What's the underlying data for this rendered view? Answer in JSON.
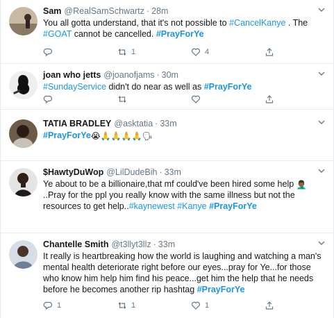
{
  "tweets": [
    {
      "name": "Sam",
      "handle": "@RealSamSchwartz",
      "sep": "·",
      "time": "28m",
      "avatar": "avatar-sam",
      "segments": [
        {
          "t": "You all gotta understand, that it's not possible to ",
          "k": "text"
        },
        {
          "t": "#CancelKanye",
          "k": "tag"
        },
        {
          "t": " . The ",
          "k": "text"
        },
        {
          "t": "#GOAT",
          "k": "tag"
        },
        {
          "t": " cannot be cancelled. ",
          "k": "text"
        },
        {
          "t": "#PrayForYe",
          "k": "tagb"
        }
      ],
      "reply_count": "",
      "retweet_count": "1",
      "like_count": "4"
    },
    {
      "name": "joan who jetts",
      "handle": "@joanofjams",
      "sep": "·",
      "time": "30m",
      "avatar": "avatar-joan",
      "segments": [
        {
          "t": "#SundayService",
          "k": "tag"
        },
        {
          "t": " didn't do near as well as ",
          "k": "text"
        },
        {
          "t": "#PrayForYe",
          "k": "tagb"
        }
      ],
      "reply_count": "",
      "retweet_count": "",
      "like_count": ""
    },
    {
      "name": "TATIA BRADLEY",
      "handle": "@asktatia",
      "sep": "·",
      "time": "33m",
      "avatar": "avatar-tatia",
      "segments": [
        {
          "t": "#PrayForYe",
          "k": "tagb"
        },
        {
          "t": " 😭🙏🙏🙏🙏🗣",
          "k": "emoji"
        }
      ],
      "reply_count": "",
      "retweet_count": "",
      "like_count": ""
    },
    {
      "name": "$HawtyDuWop",
      "handle": "@LilDudeBih",
      "sep": "·",
      "time": "33m",
      "avatar": "avatar-hawty",
      "segments": [
        {
          "t": "Ye about to be a billionaire,that mf could've been hired some help ",
          "k": "text"
        },
        {
          "t": "🤦🏾‍♂️",
          "k": "emoji"
        },
        {
          "t": "..Pray for the ppl you really know with the same illness but not the resources to get help..",
          "k": "text"
        },
        {
          "t": "#kaynewest",
          "k": "tag"
        },
        {
          "t": " ",
          "k": "text"
        },
        {
          "t": "#Kanye",
          "k": "tag"
        },
        {
          "t": " ",
          "k": "text"
        },
        {
          "t": "#PrayForYe",
          "k": "tagb"
        }
      ],
      "reply_count": "",
      "retweet_count": "",
      "like_count": ""
    },
    {
      "name": "Chantelle Smith",
      "handle": "@t3llyt3llz",
      "sep": "·",
      "time": "33m",
      "avatar": "avatar-chantelle",
      "segments": [
        {
          "t": "It really is heartbreaking how the world is laughing and watching a man's mental health deteriorate right before our eyes...pray for Ye...for those who know him help him find his peace...get him the help that he needs before he becomes another rip hashtag ",
          "k": "text"
        },
        {
          "t": "#PrayForYe",
          "k": "tagb"
        }
      ],
      "reply_count": "1",
      "retweet_count": "1",
      "like_count": "1"
    }
  ],
  "icons": {
    "reply": "reply-icon",
    "retweet": "retweet-icon",
    "like": "heart-icon",
    "share": "share-icon",
    "more": "chevron-down-icon"
  },
  "colors": {
    "link": "#1b95e0",
    "muted": "#657786",
    "text": "#14171a",
    "divider": "#e6ecf0"
  }
}
